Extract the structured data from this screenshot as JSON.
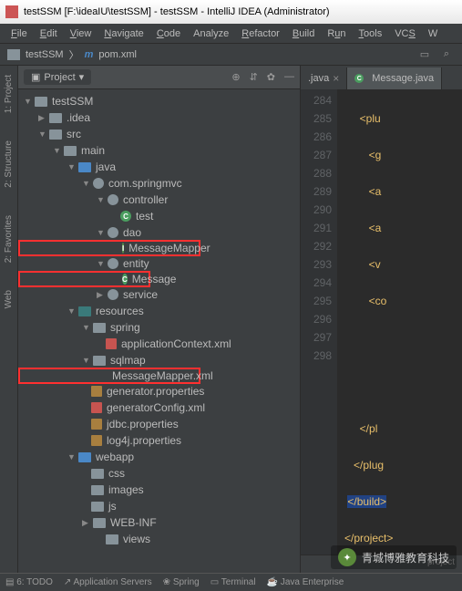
{
  "titlebar": {
    "text": "testSSM [F:\\ideaIU\\testSSM] - testSSM - IntelliJ IDEA (Administrator)"
  },
  "menu": {
    "file": "File",
    "edit": "Edit",
    "view": "View",
    "navigate": "Navigate",
    "code": "Code",
    "analyze": "Analyze",
    "refactor": "Refactor",
    "build": "Build",
    "run": "Run",
    "tools": "Tools",
    "vcs": "VCS",
    "window": "W"
  },
  "nav": {
    "root": "testSSM",
    "file": "pom.xml"
  },
  "panel": {
    "title": "Project"
  },
  "leftbar": {
    "project": "1: Project",
    "structure": "2: Structure",
    "favorites": "2: Favorites",
    "web": "Web"
  },
  "tree": {
    "root": "testSSM",
    "idea": ".idea",
    "src": "src",
    "main": "main",
    "java": "java",
    "pkg": "com.springmvc",
    "controller": "controller",
    "test": "test",
    "dao": "dao",
    "msgmapper": "MessageMapper",
    "entity": "entity",
    "message": "Message",
    "service": "service",
    "resources": "resources",
    "spring": "spring",
    "appctx": "applicationContext.xml",
    "sqlmap": "sqlmap",
    "mapperxml": "MessageMapper.xml",
    "genprop": "generator.properties",
    "gencfg": "generatorConfig.xml",
    "jdbc": "jdbc.properties",
    "log4j": "log4j.properties",
    "webapp": "webapp",
    "css": "css",
    "images": "images",
    "js": "js",
    "webinf": "WEB-INF",
    "views": "views"
  },
  "tabs": {
    "t1": ".java",
    "t2": "Message.java"
  },
  "gutter": [
    "284",
    "285",
    "286",
    "287",
    "288",
    "289",
    "290",
    "291",
    "292",
    "293",
    "294",
    "295",
    "296",
    "297",
    "298"
  ],
  "code": {
    "l0": "<plu",
    "l1": "<g",
    "l2": "<a",
    "l3": "<a",
    "l4": "<v",
    "l5": "<co",
    "l10": "</pl",
    "l11": "</plug",
    "l12a": "</",
    "l12b": "build",
    "l12c": ">",
    "l13a": "</",
    "l13b": "project",
    "l13c": ">"
  },
  "breadcrumb": {
    "text": "project"
  },
  "status": {
    "todo": "6: TODO",
    "appserv": "Application Servers",
    "spring": "Spring",
    "terminal": "Terminal",
    "javaee": "Java Enterprise"
  },
  "watermark": {
    "text": "青城博雅教育科技"
  }
}
